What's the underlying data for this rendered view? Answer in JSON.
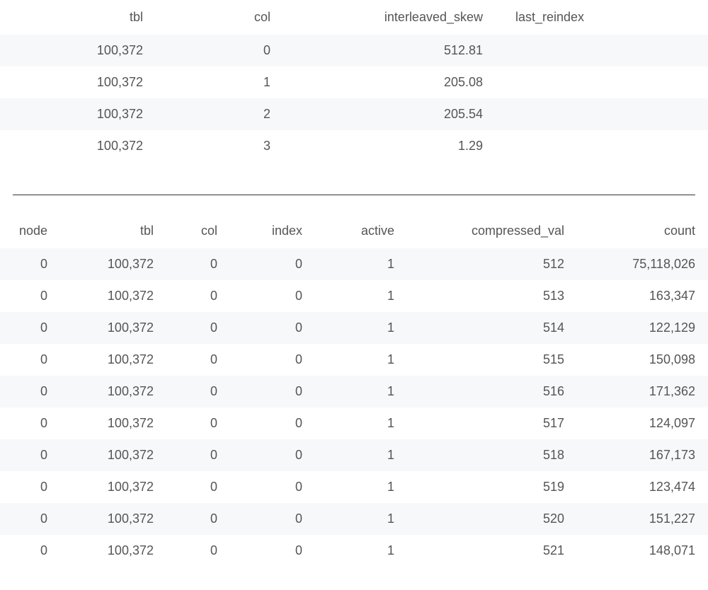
{
  "table1": {
    "headers": [
      "tbl",
      "col",
      "interleaved_skew",
      "last_reindex"
    ],
    "rows": [
      {
        "tbl": "100,372",
        "col": "0",
        "interleaved_skew": "512.81",
        "last_reindex": ""
      },
      {
        "tbl": "100,372",
        "col": "1",
        "interleaved_skew": "205.08",
        "last_reindex": ""
      },
      {
        "tbl": "100,372",
        "col": "2",
        "interleaved_skew": "205.54",
        "last_reindex": ""
      },
      {
        "tbl": "100,372",
        "col": "3",
        "interleaved_skew": "1.29",
        "last_reindex": ""
      }
    ]
  },
  "table2": {
    "headers": [
      "node",
      "tbl",
      "col",
      "index",
      "active",
      "compressed_val",
      "count"
    ],
    "rows": [
      {
        "node": "0",
        "tbl": "100,372",
        "col": "0",
        "index": "0",
        "active": "1",
        "compressed_val": "512",
        "count": "75,118,026"
      },
      {
        "node": "0",
        "tbl": "100,372",
        "col": "0",
        "index": "0",
        "active": "1",
        "compressed_val": "513",
        "count": "163,347"
      },
      {
        "node": "0",
        "tbl": "100,372",
        "col": "0",
        "index": "0",
        "active": "1",
        "compressed_val": "514",
        "count": "122,129"
      },
      {
        "node": "0",
        "tbl": "100,372",
        "col": "0",
        "index": "0",
        "active": "1",
        "compressed_val": "515",
        "count": "150,098"
      },
      {
        "node": "0",
        "tbl": "100,372",
        "col": "0",
        "index": "0",
        "active": "1",
        "compressed_val": "516",
        "count": "171,362"
      },
      {
        "node": "0",
        "tbl": "100,372",
        "col": "0",
        "index": "0",
        "active": "1",
        "compressed_val": "517",
        "count": "124,097"
      },
      {
        "node": "0",
        "tbl": "100,372",
        "col": "0",
        "index": "0",
        "active": "1",
        "compressed_val": "518",
        "count": "167,173"
      },
      {
        "node": "0",
        "tbl": "100,372",
        "col": "0",
        "index": "0",
        "active": "1",
        "compressed_val": "519",
        "count": "123,474"
      },
      {
        "node": "0",
        "tbl": "100,372",
        "col": "0",
        "index": "0",
        "active": "1",
        "compressed_val": "520",
        "count": "151,227"
      },
      {
        "node": "0",
        "tbl": "100,372",
        "col": "0",
        "index": "0",
        "active": "1",
        "compressed_val": "521",
        "count": "148,071"
      }
    ]
  }
}
